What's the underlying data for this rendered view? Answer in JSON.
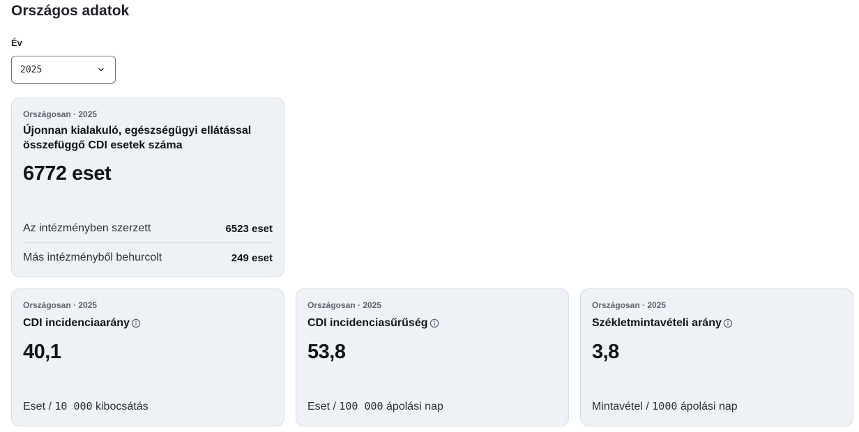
{
  "page": {
    "title": "Országos adatok"
  },
  "year_filter": {
    "label": "Év",
    "value": "2025",
    "icon": "chevron-down-icon"
  },
  "main_card": {
    "eyebrow": "Országosan · 2025",
    "title": "Újonnan kialakuló, egészségügyi ellátással összefüggő CDI esetek száma",
    "total": "6772 eset",
    "breakdown": [
      {
        "label": "Az intézményben szerzett",
        "value": "6523 eset"
      },
      {
        "label": "Más intézményből behurcolt",
        "value": "249 eset"
      }
    ]
  },
  "metrics": [
    {
      "eyebrow": "Országosan · 2025",
      "title": "CDI incidenciaarány",
      "value": "40,1",
      "unit_prefix": "Eset / ",
      "unit_number": "10 000",
      "unit_suffix": " kibocsátás",
      "icon": "info-icon"
    },
    {
      "eyebrow": "Országosan · 2025",
      "title": "CDI incidenciasűrűség",
      "value": "53,8",
      "unit_prefix": "Eset / ",
      "unit_number": "100 000",
      "unit_suffix": " ápolási nap",
      "icon": "info-icon"
    },
    {
      "eyebrow": "Országosan · 2025",
      "title": "Székletmintavételi arány",
      "value": "3,8",
      "unit_prefix": "Mintavétel / ",
      "unit_number": "1000",
      "unit_suffix": " ápolási nap",
      "icon": "info-icon"
    }
  ],
  "colors": {
    "card_bg": "#eef1f5",
    "card_border": "#d6dce4",
    "text": "#111418",
    "muted": "#5c6470"
  }
}
